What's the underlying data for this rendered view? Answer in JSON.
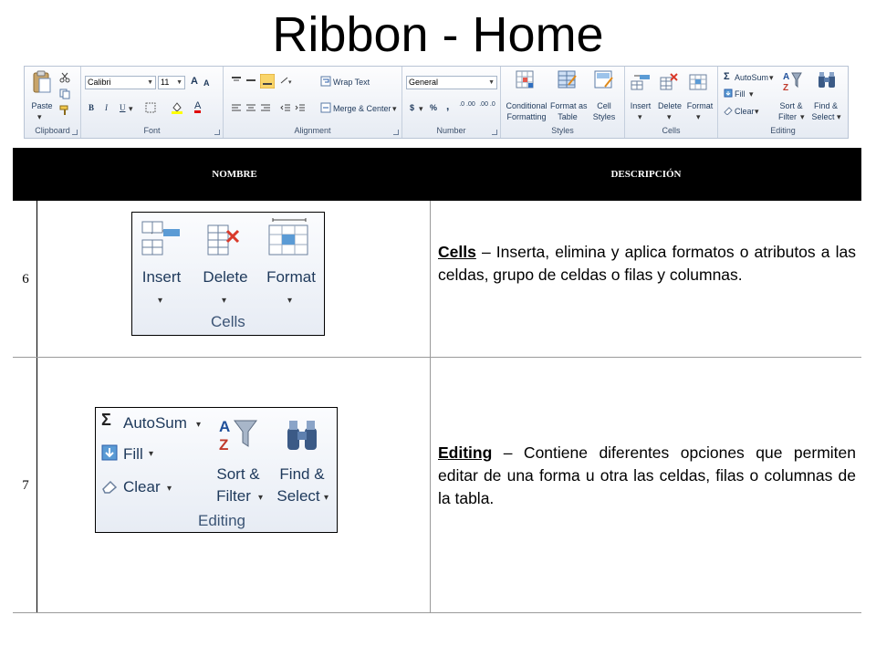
{
  "slide": {
    "title": "Ribbon - Home"
  },
  "ribbon": {
    "clipboard": {
      "label": "Clipboard",
      "paste": "Paste"
    },
    "font": {
      "label": "Font",
      "name": "Calibri",
      "size": "11",
      "bold": "B",
      "italic": "I",
      "underline": "U",
      "grow": "A",
      "shrink": "A",
      "color": "A"
    },
    "alignment": {
      "label": "Alignment",
      "wrap": "Wrap Text",
      "merge": "Merge & Center"
    },
    "number": {
      "label": "Number",
      "format": "General",
      "currency": "$",
      "percent": "%",
      "comma": ",",
      "inc": ".0 .00",
      "dec": ".00 .0"
    },
    "styles": {
      "label": "Styles",
      "conditional_1": "Conditional",
      "conditional_2": "Formatting",
      "format_table_1": "Format as",
      "format_table_2": "Table",
      "cell_styles_1": "Cell",
      "cell_styles_2": "Styles"
    },
    "cells": {
      "label": "Cells",
      "insert": "Insert",
      "delete": "Delete",
      "format": "Format"
    },
    "editing": {
      "label": "Editing",
      "autosum": "AutoSum",
      "fill": "Fill",
      "clear": "Clear",
      "sort_1": "Sort &",
      "sort_2": "Filter",
      "find_1": "Find &",
      "find_2": "Select"
    }
  },
  "table": {
    "headers": {
      "name": "NOMBRE",
      "description": "DESCRIPCIÓN"
    },
    "rows": [
      {
        "number": "6",
        "panel": {
          "insert": "Insert",
          "delete": "Delete",
          "format": "Format",
          "label": "Cells"
        },
        "term": "Cells",
        "text": " – Inserta, elimina y aplica formatos o atributos a las celdas, grupo de celdas o filas y columnas."
      },
      {
        "number": "7",
        "panel": {
          "autosum": "AutoSum",
          "fill": "Fill",
          "clear": "Clear",
          "sort_1": "Sort &",
          "sort_2": "Filter",
          "find_1": "Find &",
          "find_2": "Select",
          "label": "Editing"
        },
        "term": "Editing",
        "text": " – Contiene diferentes opciones que permiten editar de una forma u otra las celdas, filas o columnas de la tabla."
      }
    ]
  },
  "colors": {
    "header_bg": "#000000",
    "ribbon_text": "#1e395b",
    "panel_label": "#3b5475",
    "border": "#9a9a9a"
  }
}
